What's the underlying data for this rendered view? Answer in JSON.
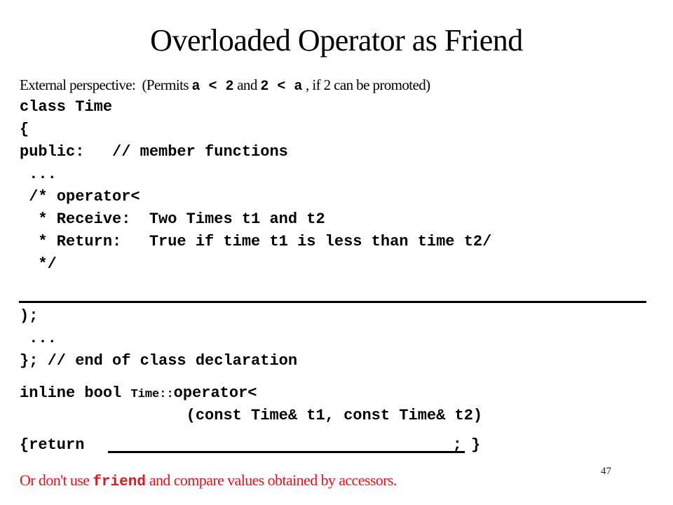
{
  "slide": {
    "title": "Overloaded Operator as Friend",
    "page_number": "47"
  },
  "intro": {
    "prefix": "External perspective:  (Permits ",
    "expr1": "a < 2",
    "middle": " and ",
    "expr2": "2 < a",
    "suffix": " , if 2 can be promoted)"
  },
  "class_code": {
    "lines": [
      "class Time",
      "{",
      "public:   // member functions",
      " ...",
      " /* operator<",
      "  * Receive:  Two Times t1 and t2",
      "  * Return:   True if time t1 is less than time t2/",
      "  */",
      ");",
      " ...",
      "}; // end of class declaration"
    ]
  },
  "definition_code": {
    "line1_prefix": "inline bool ",
    "line1_scope": "Time::",
    "line1_suffix": "operator<",
    "line2": "                  (const Time& t1, const Time& t2)",
    "line3_prefix": "{return ",
    "line3_suffix": "; }"
  },
  "footnote": {
    "prefix": "Or don't use ",
    "keyword": "friend",
    "suffix": " and compare values obtained by accessors.",
    "color": "#e8141b"
  }
}
